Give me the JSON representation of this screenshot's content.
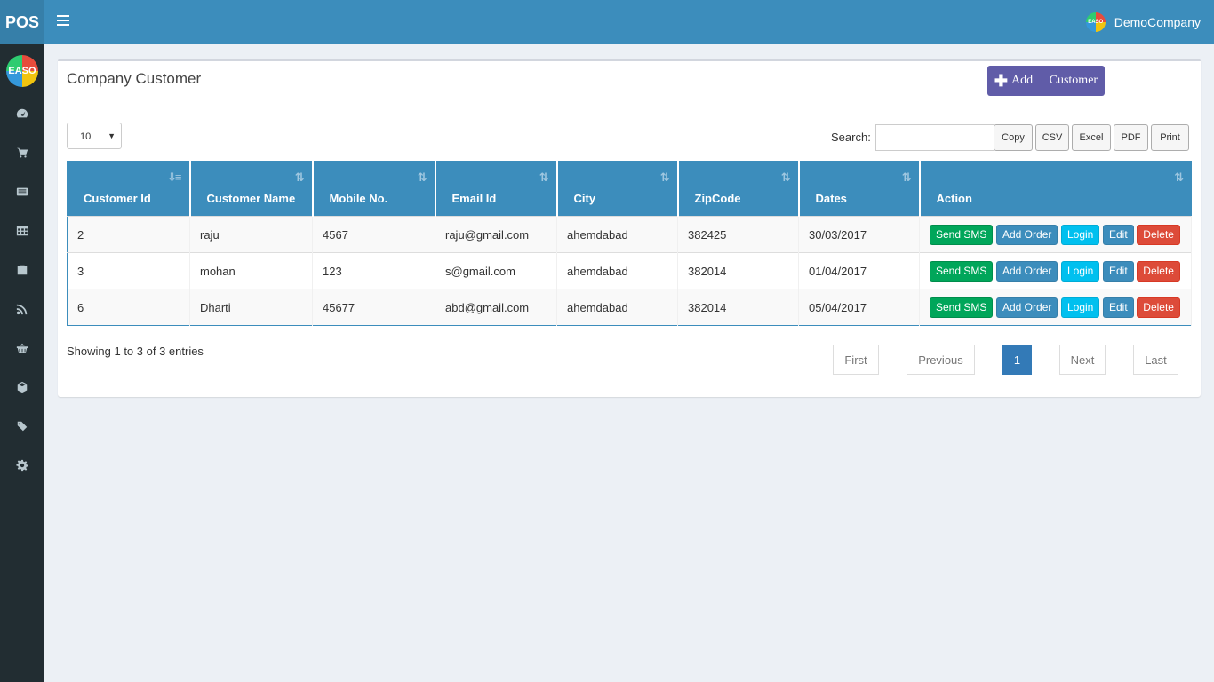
{
  "app": {
    "brand": "POS",
    "company": "DemoCompany",
    "avatar_text": "EASO",
    "side_logo_text": "EASO"
  },
  "sidebar": {
    "icons": [
      "dashboard-icon",
      "cart-icon",
      "list-icon",
      "table-icon",
      "briefcase-icon",
      "rss-icon",
      "basket-icon",
      "cube-icon",
      "tags-icon",
      "gear-icon"
    ]
  },
  "page": {
    "title": "Company Customer",
    "add_button": "Add",
    "add_button_suffix": "Customer"
  },
  "controls": {
    "page_length": "10",
    "search_label": "Search:",
    "search_value": "",
    "exports": [
      "Copy",
      "CSV",
      "Excel",
      "PDF",
      "Print"
    ]
  },
  "table": {
    "headers": [
      "Customer Id",
      "Customer Name",
      "Mobile No.",
      "Email Id",
      "City",
      "ZipCode",
      "Dates",
      "Action"
    ],
    "rows": [
      {
        "id": "2",
        "name": "raju",
        "mobile": "4567",
        "email": "raju@gmail.com",
        "city": "ahemdabad",
        "zip": "382425",
        "date": "30/03/2017"
      },
      {
        "id": "3",
        "name": "mohan",
        "mobile": "123",
        "email": "s@gmail.com",
        "city": "ahemdabad",
        "zip": "382014",
        "date": "01/04/2017"
      },
      {
        "id": "6",
        "name": "Dharti",
        "mobile": "45677",
        "email": "abd@gmail.com",
        "city": "ahemdabad",
        "zip": "382014",
        "date": "05/04/2017"
      }
    ],
    "actions": {
      "sms": "Send SMS",
      "order": "Add Order",
      "login": "Login",
      "edit": "Edit",
      "delete": "Delete"
    }
  },
  "footer": {
    "info": "Showing 1 to 3 of 3 entries",
    "pagination": {
      "first": "First",
      "previous": "Previous",
      "current": "1",
      "next": "Next",
      "last": "Last"
    }
  },
  "colors": {
    "header": "#3c8dbc",
    "logo_bg": "#367fa9",
    "sidebar": "#222d32",
    "add_button": "#605ca8",
    "sms": "#00a65a",
    "login": "#00c0ef",
    "delete": "#dd4b39"
  }
}
